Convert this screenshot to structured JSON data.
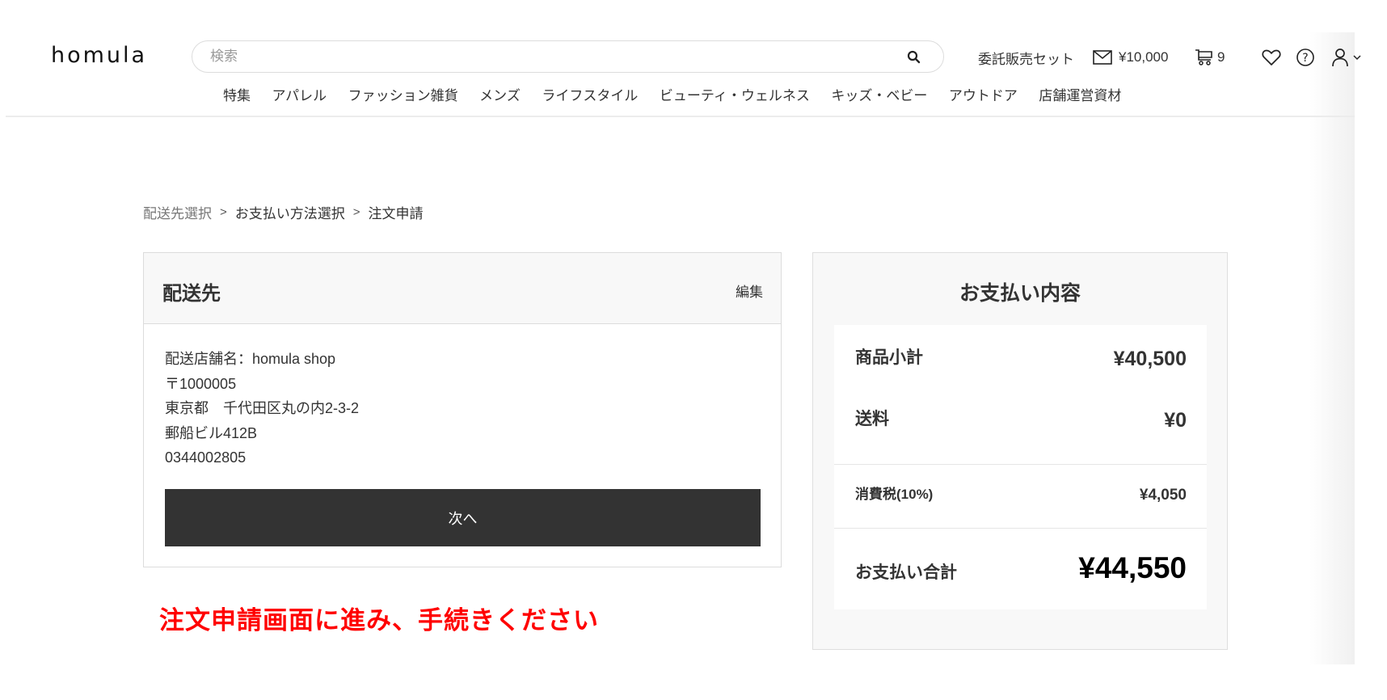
{
  "header": {
    "logo": "homula",
    "search": {
      "placeholder": "検索",
      "value": ""
    },
    "utilities": {
      "consignment_label": "委託販売セット",
      "mail_balance": "¥10,000",
      "cart_count": "9"
    },
    "nav": [
      "特集",
      "アパレル",
      "ファッション雑貨",
      "メンズ",
      "ライフスタイル",
      "ビューティ・ウェルネス",
      "キッズ・ベビー",
      "アウトドア",
      "店舗運営資材"
    ]
  },
  "breadcrumb": {
    "items": [
      "配送先選択",
      "お支払い方法選択",
      "注文申請"
    ],
    "separator": ">"
  },
  "shipping": {
    "title": "配送先",
    "edit_label": "編集",
    "address_lines": [
      "配送店舗名：homula shop",
      "〒1000005",
      "東京都　千代田区丸の内2-3-2",
      "郵船ビル412B",
      "0344002805"
    ],
    "next_label": "次へ"
  },
  "notice": "注文申請画面に進み、手続きください",
  "payment": {
    "title": "お支払い内容",
    "rows": [
      {
        "label": "商品小計",
        "value": "¥40,500"
      },
      {
        "label": "送料",
        "value": "¥0"
      },
      {
        "label": "消費税(10%)",
        "value": "¥4,050"
      },
      {
        "label": "お支払い合計",
        "value": "¥44,550"
      }
    ]
  },
  "colors": {
    "button_bg": "#333333",
    "notice": "#ff0000",
    "panel_bg": "#f8f8f8"
  }
}
